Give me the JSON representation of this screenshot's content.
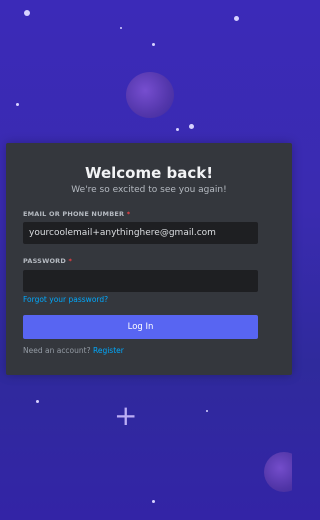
{
  "login": {
    "title": "Welcome back!",
    "subtitle": "We're so excited to see you again!",
    "email_label": "EMAIL OR PHONE NUMBER",
    "email_value": "yourcoolemail+anythinghere@gmail.com",
    "password_label": "PASSWORD",
    "password_value": "",
    "required_marker": "*",
    "forgot_password": "Forgot your password?",
    "login_button": "Log In",
    "need_account": "Need an account?",
    "register_link": "Register"
  },
  "colors": {
    "background": "#3a2bb0",
    "card": "#34373d",
    "input": "#1e1f22",
    "button": "#5865f2",
    "link": "#00a8fc"
  }
}
